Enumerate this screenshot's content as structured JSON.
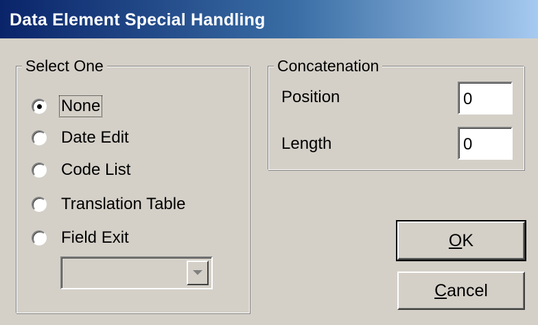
{
  "window": {
    "title": "Data Element Special Handling"
  },
  "select_one": {
    "label": "Select One",
    "options": [
      {
        "label": "None",
        "selected": true
      },
      {
        "label": "Date Edit",
        "selected": false
      },
      {
        "label": "Code List",
        "selected": false
      },
      {
        "label": "Translation Table",
        "selected": false
      },
      {
        "label": "Field Exit",
        "selected": false
      }
    ],
    "field_exit_dropdown": {
      "value": "",
      "enabled": false
    }
  },
  "concatenation": {
    "label": "Concatenation",
    "position": {
      "label": "Position",
      "value": "0"
    },
    "length": {
      "label": "Length",
      "value": "0"
    }
  },
  "buttons": {
    "ok": {
      "mnemonic": "O",
      "rest": "K"
    },
    "cancel": {
      "mnemonic": "C",
      "rest": "ancel"
    }
  },
  "colors": {
    "face": "#d4d0c8",
    "title_start": "#0a246a",
    "title_end": "#a6caf0"
  },
  "icons": [
    "radio-selected-icon",
    "radio-unselected-icon",
    "dropdown-arrow-icon"
  ]
}
